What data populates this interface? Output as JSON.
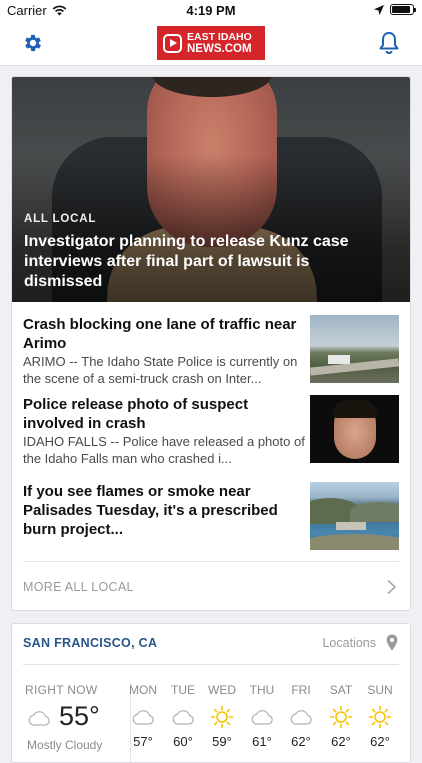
{
  "status_bar": {
    "carrier": "Carrier",
    "time": "4:19 PM"
  },
  "header": {
    "logo_line1": "EAST IDAHO",
    "logo_line2": "NEWS.COM"
  },
  "hero": {
    "category": "ALL LOCAL",
    "headline": "Investigator planning to release Kunz case interviews after final part of lawsuit is dismissed"
  },
  "articles": [
    {
      "title": "Crash blocking one lane of traffic near Arimo",
      "summary": "ARIMO -- The Idaho State Police is currently on the scene of a semi-truck crash on Inter..."
    },
    {
      "title": "Police release photo of suspect involved in crash",
      "summary": "IDAHO FALLS -- Police have released a photo of the Idaho Falls man who crashed i..."
    },
    {
      "title": "If you see flames or smoke near Palisades Tuesday, it's a prescribed burn project...",
      "summary": ""
    }
  ],
  "more_link": "MORE ALL LOCAL",
  "weather": {
    "city": "SAN FRANCISCO, CA",
    "locations_label": "Locations",
    "now_label": "RIGHT NOW",
    "now_temp": "55°",
    "now_condition": "Mostly Cloudy",
    "days": [
      {
        "name": "MON",
        "icon": "cloud-icon",
        "temp": "57°"
      },
      {
        "name": "TUE",
        "icon": "cloud-icon",
        "temp": "60°"
      },
      {
        "name": "WED",
        "icon": "sun-icon",
        "temp": "59°"
      },
      {
        "name": "THU",
        "icon": "cloud-icon",
        "temp": "61°"
      },
      {
        "name": "FRI",
        "icon": "cloud-icon",
        "temp": "62°"
      },
      {
        "name": "SAT",
        "icon": "sun-icon",
        "temp": "62°"
      },
      {
        "name": "SUN",
        "icon": "sun-icon",
        "temp": "62°"
      }
    ]
  },
  "colors": {
    "brand_red": "#d3252a",
    "nav_blue": "#1f5fb4",
    "city_blue": "#28548a",
    "sun_yellow": "#f5c400"
  }
}
